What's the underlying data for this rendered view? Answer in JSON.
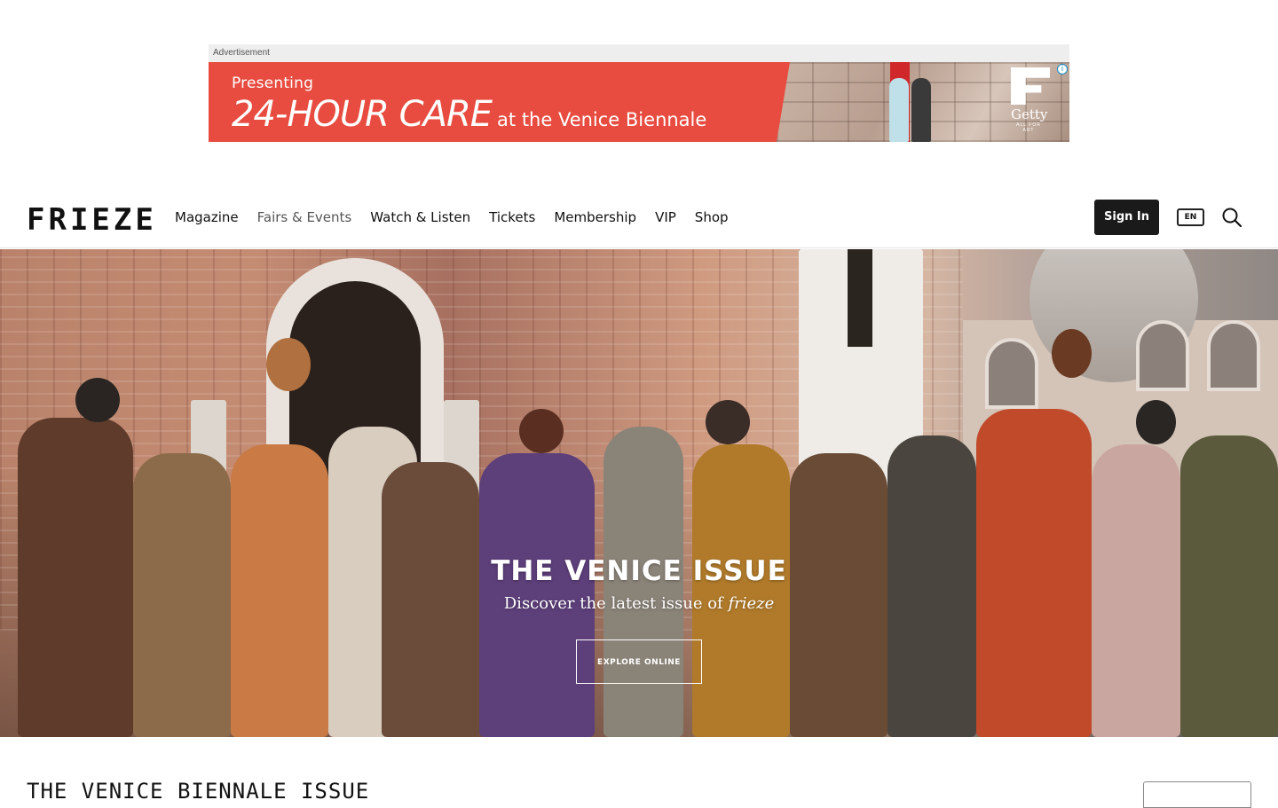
{
  "ad": {
    "label": "Advertisement",
    "presenting": "Presenting",
    "headline": "24-HOUR CARE",
    "subline": "at the Venice Biennale",
    "logo_name": "Getty",
    "logo_tagline": "ALL FOR ART",
    "info_icon": "info-icon",
    "colors": {
      "banner": "#e84b3f"
    }
  },
  "header": {
    "logo": "FRIEZE",
    "nav": [
      "Magazine",
      "Fairs & Events",
      "Watch & Listen",
      "Tickets",
      "Membership",
      "VIP",
      "Shop"
    ],
    "sign_in": "Sign In",
    "language": "EN",
    "search_icon": "search-icon"
  },
  "hero": {
    "title": "THE VENICE ISSUE",
    "subtitle_prefix": "Discover the latest issue of ",
    "subtitle_italic": "frieze",
    "button": "EXPLORE ONLINE"
  },
  "section": {
    "title": "THE VENICE BIENNALE ISSUE"
  }
}
